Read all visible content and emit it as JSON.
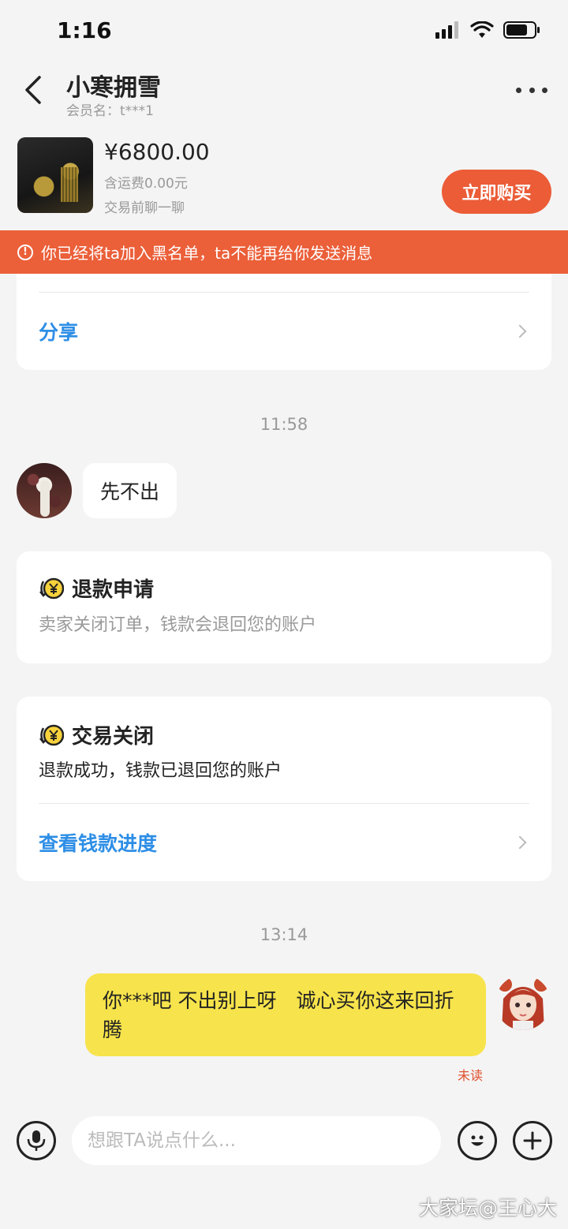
{
  "status_bar": {
    "time": "1:16",
    "icons": [
      "signal-icon",
      "wifi-icon",
      "battery-icon"
    ]
  },
  "header": {
    "title": "小寒拥雪",
    "subtitle": "会员名：t***1"
  },
  "product": {
    "price": "¥6800.00",
    "shipping": "含运费0.00元",
    "note": "交易前聊一聊",
    "buy_label": "立即购买"
  },
  "warning": {
    "text": "你已经将ta加入黑名单，ta不能再给你发送消息"
  },
  "share_card": {
    "link": "分享"
  },
  "messages": {
    "time_1": "11:58",
    "other_text": "先不出",
    "refund_card": {
      "title": "退款申请",
      "desc": "卖家关闭订单，钱款会退回您的账户"
    },
    "closed_card": {
      "title": "交易关闭",
      "desc": "退款成功，钱款已退回您的账户",
      "link": "查看钱款进度"
    },
    "time_2": "13:14",
    "my_text": "你***吧 不出别上呀　诚心买你这来回折腾",
    "unread_label": "未读"
  },
  "input": {
    "placeholder": "想跟TA说点什么..."
  },
  "watermark": "大家坛@王心大",
  "colors": {
    "accent": "#eb5c37",
    "link": "#2d8ee6",
    "my_bubble": "#f7e34b",
    "background": "#f4f4f4"
  }
}
